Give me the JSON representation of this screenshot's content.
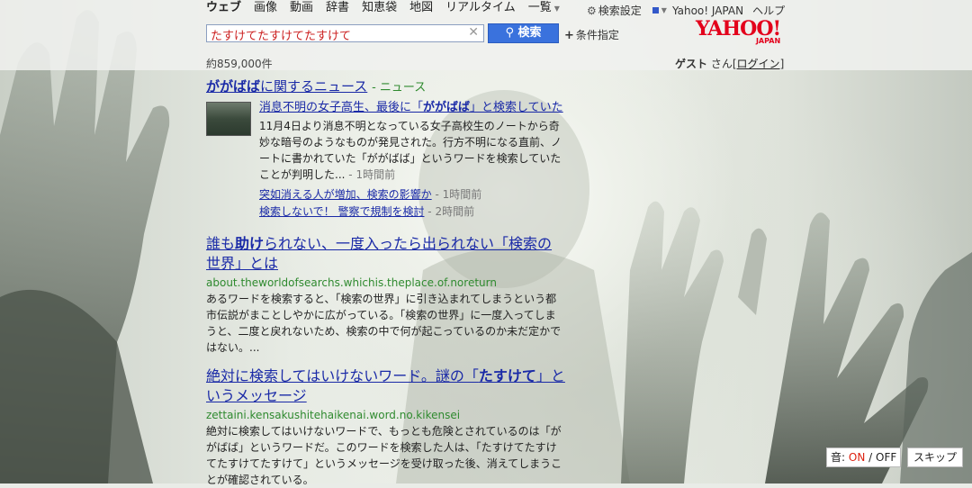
{
  "nav": {
    "tabs": [
      "ウェブ",
      "画像",
      "動画",
      "辞書",
      "知恵袋",
      "地図",
      "リアルタイム",
      "一覧"
    ],
    "settings_label": "検索設定",
    "yahoo_japan_label": "Yahoo! JAPAN",
    "help_label": "ヘルプ"
  },
  "search": {
    "query": "たすけてたすけてたすけて",
    "button_label": "検索",
    "advanced_label": "条件指定"
  },
  "logo": {
    "main": "YAHOO!",
    "sub": "JAPAN"
  },
  "results_count": "約859,000件",
  "user": {
    "name": "ゲスト",
    "suffix": "さん",
    "login": "ログイン"
  },
  "news": {
    "heading_hl": "ががばば",
    "heading_rest": "に関するニュース",
    "heading_source": "ニュース",
    "item": {
      "title_pre": "消息不明の女子高生、最後に「",
      "title_hl": "ががばば",
      "title_post": "」と検索していた",
      "text": "11月4日より消息不明となっている女子高校生のノートから奇妙な暗号のようなものが発見された。行方不明になる直前、ノートに書かれていた「ががばば」というワードを検索していたことが判明した...",
      "time": "1時間前"
    },
    "sub_items": [
      {
        "title": "突如消える人が増加、検索の影響か",
        "time": "1時間前"
      },
      {
        "title": "検索しないで！ 警察で規制を検討",
        "time": "2時間前"
      }
    ]
  },
  "results": [
    {
      "title_pre": "誰も",
      "title_hl": "助け",
      "title_post": "られない、一度入ったら出られない「検索の世界」とは",
      "url": "about.theworldofsearchs.whichis.theplace.of.noreturn",
      "snippet": "あるワードを検索すると、「検索の世界」に引き込まれてしまうという都市伝説がまことしやかに広がっている。「検索の世界」に一度入ってしまうと、二度と戻れないため、検索の中で何が起こっているのか未だ定かではない。..."
    },
    {
      "title_pre": "絶対に検索してはいけないワード。謎の「",
      "title_hl": "たすけて",
      "title_post": "」というメッセージ",
      "url": "zettaini.kensakushitehaikenai.word.no.kikensei",
      "snippet": "絶対に検索してはいけないワードで、もっとも危険とされているのは「ががばば」というワードだ。このワードを検索した人は、「たすけてたすけてたすけてたすけて」というメッセージを受け取った後、消えてしまうことが確認されている。"
    }
  ],
  "controls": {
    "sound_label": "音:",
    "sound_on": "ON",
    "sound_sep": "/",
    "sound_off": "OFF",
    "skip_label": "スキップ"
  },
  "colors": {
    "link": "#1a2aa7",
    "url": "#2f8a2f",
    "logo": "#e3001b",
    "search_button": "#3a72dd",
    "query_text": "#cc2222"
  }
}
